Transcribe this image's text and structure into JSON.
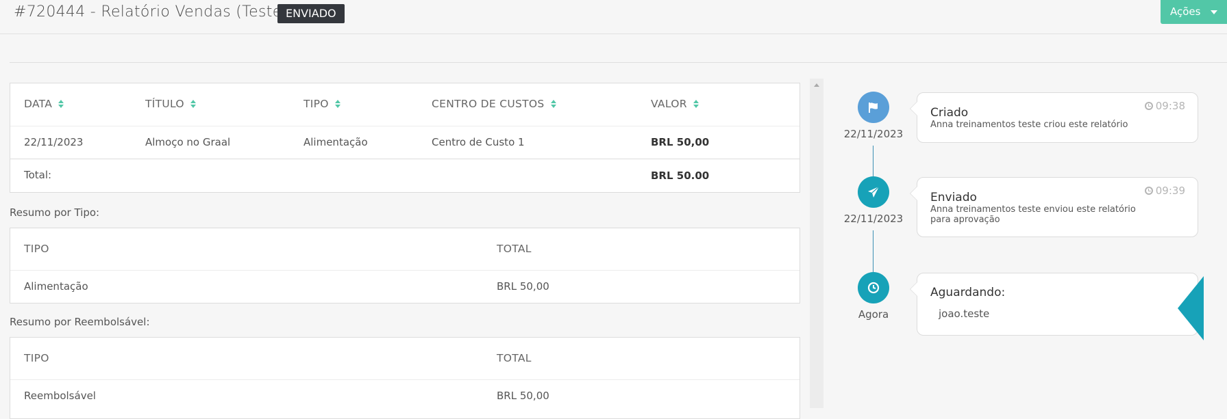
{
  "header": {
    "title": "#720444 - Relatório Vendas (Teste)",
    "status": "ENVIADO",
    "actions_label": "Ações"
  },
  "expenses_table": {
    "columns": [
      "DATA",
      "TÍTULO",
      "TIPO",
      "CENTRO DE CUSTOS",
      "VALOR"
    ],
    "rows": [
      {
        "date": "22/11/2023",
        "title": "Almoço no Graal",
        "type": "Alimentação",
        "cost_center": "Centro de Custo 1",
        "value": "BRL 50,00"
      }
    ],
    "total_label": "Total:",
    "total_value": "BRL 50.00"
  },
  "summary_by_type": {
    "heading": "Resumo por Tipo:",
    "columns": [
      "TIPO",
      "TOTAL"
    ],
    "rows": [
      {
        "type": "Alimentação",
        "total": "BRL 50,00"
      }
    ]
  },
  "summary_by_reimbursable": {
    "heading": "Resumo por Reembolsável:",
    "columns": [
      "TIPO",
      "TOTAL"
    ],
    "rows": [
      {
        "type": "Reembolsável",
        "total": "BRL 50,00"
      }
    ]
  },
  "timeline": [
    {
      "icon": "flag-icon",
      "date": "22/11/2023",
      "title": "Criado",
      "description": "Anna treinamentos teste criou este relatório",
      "time": "09:38",
      "color": "#5a9fd8"
    },
    {
      "icon": "paper-plane-icon",
      "date": "22/11/2023",
      "title": "Enviado",
      "description": "Anna treinamentos teste enviou este relatório para aprovação",
      "time": "09:39",
      "color": "#17a2b8"
    },
    {
      "icon": "clock-icon",
      "date": "Agora",
      "title": "Aguardando:",
      "description": "joao.teste",
      "time": "",
      "color": "#17a2b8"
    }
  ],
  "colors": {
    "accent": "#52c7a7",
    "badge": "#34373d",
    "timeline_blue": "#5a9fd8",
    "timeline_teal": "#17a2b8"
  }
}
